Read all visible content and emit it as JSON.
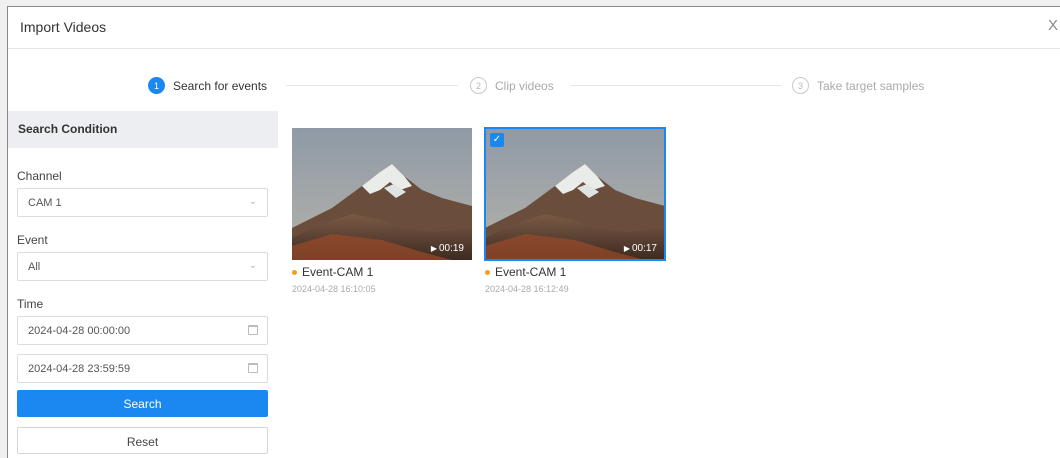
{
  "dialog": {
    "title": "Import Videos",
    "close_glyph": "X"
  },
  "steps": [
    {
      "number": "1",
      "label": "Search for events",
      "state": "active"
    },
    {
      "number": "2",
      "label": "Clip videos",
      "state": "inactive"
    },
    {
      "number": "3",
      "label": "Take target samples",
      "state": "inactive"
    }
  ],
  "search": {
    "heading": "Search Condition",
    "channel_label": "Channel",
    "channel_value": "CAM 1",
    "event_label": "Event",
    "event_value": "All",
    "time_label": "Time",
    "start_time": "2024-04-28 00:00:00",
    "end_time": "2024-04-28 23:59:59",
    "search_label": "Search",
    "reset_label": "Reset"
  },
  "clips": [
    {
      "name": "Event-CAM 1",
      "time": "2024-04-28 16:10:05",
      "duration": "00:19",
      "selected": false
    },
    {
      "name": "Event-CAM 1",
      "time": "2024-04-28 16:12:49",
      "duration": "00:17",
      "selected": true
    }
  ],
  "icons": {
    "chevron": "chevron-down-icon",
    "calendar": "calendar-icon",
    "play": "play-icon",
    "check": "checkmark-icon"
  },
  "colors": {
    "accent": "#1a88f0",
    "event_dot": "#f0a020"
  }
}
